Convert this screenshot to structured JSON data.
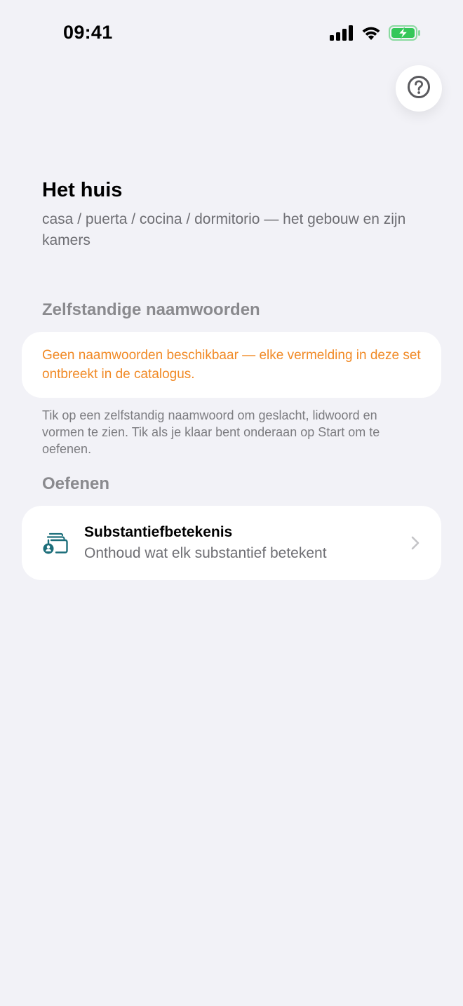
{
  "status_bar": {
    "time": "09:41",
    "icons": [
      "cellular-signal-icon",
      "wifi-icon",
      "battery-charging-icon"
    ]
  },
  "help_button": {
    "icon": "question-circle-icon"
  },
  "header": {
    "title": "Het huis",
    "subtitle": "casa / puerta / cocina / dormitorio — het gebouw en zijn kamers"
  },
  "nouns_section": {
    "header": "Zelfstandige naamwoorden",
    "empty_notice": "Geen naamwoorden beschikbaar — elke vermelding in deze set ontbreekt in de catalogus.",
    "footnote": "Tik op een zelfstandig naamwoord om geslacht, lidwoord en vormen te zien. Tik als je klaar bent onderaan op Start om te oefenen."
  },
  "practice_section": {
    "header": "Oefenen",
    "items": [
      {
        "icon": "flashcards-person-icon",
        "title": "Substantiefbetekenis",
        "subtitle": "Onthoud wat elk substantief betekent"
      }
    ]
  },
  "colors": {
    "background": "#f2f2f7",
    "card": "#ffffff",
    "warning_text": "#f18a26",
    "accent_teal": "#1c6e7a",
    "battery_green": "#34c759",
    "secondary_text": "#6e6e73"
  }
}
